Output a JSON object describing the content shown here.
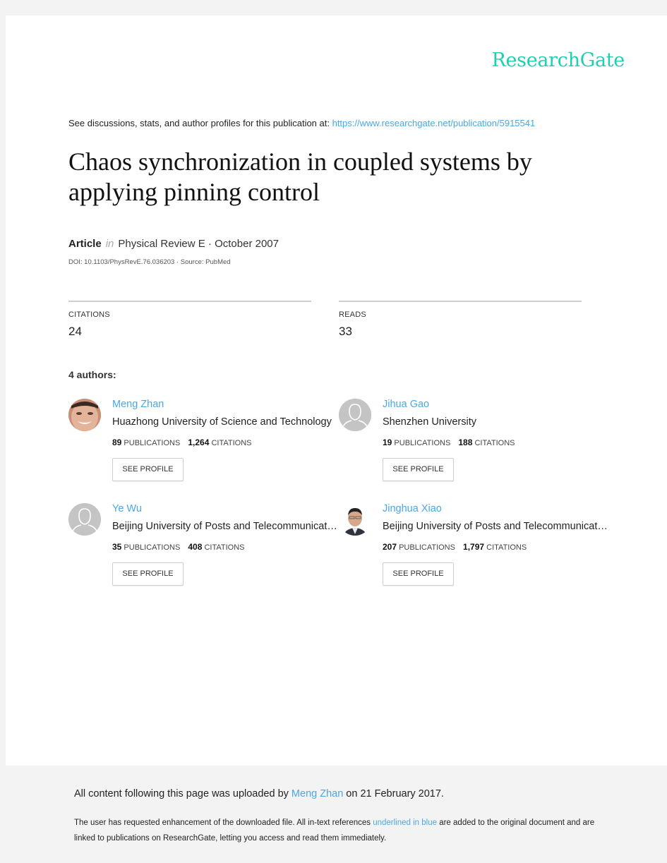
{
  "brand": {
    "logo_text": "ResearchGate",
    "accent_color": "#1fcfb0",
    "link_color": "#4aa8e5"
  },
  "intro": {
    "text": "See discussions, stats, and author profiles for this publication at: ",
    "url_text": "https://www.researchgate.net/publication/5915541"
  },
  "publication": {
    "title": "Chaos synchronization in coupled systems by applying pinning control",
    "type": "Article",
    "in_label": "in",
    "venue_date": "Physical Review E · October 2007",
    "doi_line": "DOI: 10.1103/PhysRevE.76.036203 · Source: PubMed"
  },
  "stats": {
    "citations_label": "CITATIONS",
    "citations_value": "24",
    "reads_label": "READS",
    "reads_value": "33"
  },
  "authors_header": "4 authors:",
  "authors": [
    {
      "name": "Meng Zhan",
      "institution": "Huazhong University of Science and Technology",
      "publications": "89",
      "publications_label": "PUBLICATIONS",
      "citations": "1,264",
      "citations_label": "CITATIONS",
      "button": "SEE PROFILE",
      "avatar": "photo"
    },
    {
      "name": "Jihua Gao",
      "institution": "Shenzhen University",
      "publications": "19",
      "publications_label": "PUBLICATIONS",
      "citations": "188",
      "citations_label": "CITATIONS",
      "button": "SEE PROFILE",
      "avatar": "placeholder"
    },
    {
      "name": "Ye Wu",
      "institution": "Beijing University of Posts and Telecommunications",
      "publications": "35",
      "publications_label": "PUBLICATIONS",
      "citations": "408",
      "citations_label": "CITATIONS",
      "button": "SEE PROFILE",
      "avatar": "placeholder"
    },
    {
      "name": "Jinghua Xiao",
      "institution": "Beijing University of Posts and Telecommunications",
      "publications": "207",
      "publications_label": "PUBLICATIONS",
      "citations": "1,797",
      "citations_label": "CITATIONS",
      "button": "SEE PROFILE",
      "avatar": "photo"
    }
  ],
  "footer": {
    "upload_prefix": "All content following this page was uploaded by ",
    "upload_user": "Meng Zhan",
    "upload_suffix": " on 21 February 2017.",
    "note_prefix": "The user has requested enhancement of the downloaded file. All in-text references ",
    "note_link": "underlined in blue",
    "note_suffix": " are added to the original document and are linked to publications on ResearchGate, letting you access and read them immediately."
  }
}
